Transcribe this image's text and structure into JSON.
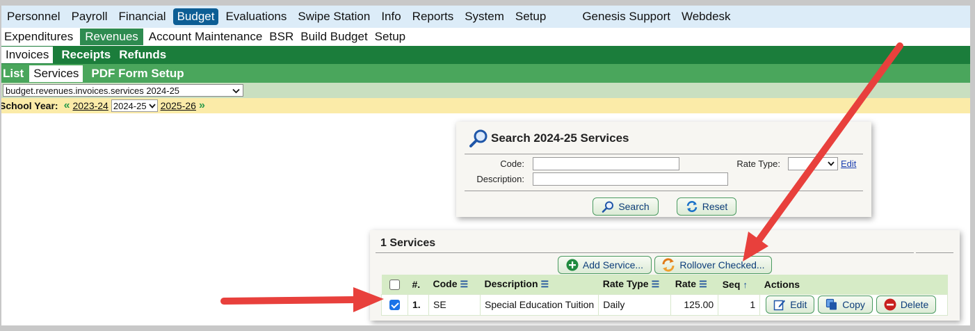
{
  "menu_main": [
    "Personnel",
    "Payroll",
    "Financial",
    "Budget",
    "Evaluations",
    "Swipe Station",
    "Info",
    "Reports",
    "System",
    "Setup",
    "Genesis Support",
    "Webdesk"
  ],
  "menu_budget": [
    "Expenditures",
    "Revenues",
    "Account Maintenance",
    "BSR",
    "Build Budget",
    "Setup"
  ],
  "menu_revenues": [
    "Invoices",
    "Receipts",
    "Refunds"
  ],
  "menu_invoices": [
    "List",
    "Services",
    "PDF Form Setup"
  ],
  "page_select": "budget.revenues.invoices.services 2024-25",
  "school_year": {
    "label": "School Year:",
    "prev": "2023-24",
    "current": "2024-25",
    "next": "2025-26"
  },
  "search": {
    "title": "Search 2024-25 Services",
    "code_label": "Code:",
    "description_label": "Description:",
    "rate_type_label": "Rate Type:",
    "edit_link": "Edit",
    "search_button": "Search",
    "reset_button": "Reset"
  },
  "services": {
    "title": "1 Services",
    "add_button": "Add Service...",
    "rollover_button": "Rollover Checked...",
    "columns": [
      "#.",
      "Code",
      "Description",
      "Rate Type",
      "Rate",
      "Seq",
      "Actions"
    ],
    "rows": [
      {
        "num": "1.",
        "code": "SE",
        "description": "Special Education Tuition",
        "rate_type": "Daily",
        "rate": "125.00",
        "seq": "1",
        "checked": true
      }
    ],
    "edit_button": "Edit",
    "copy_button": "Copy",
    "delete_button": "Delete"
  },
  "colors": {
    "arrow": "#e8403c",
    "active_budget": "#0d5e95",
    "green_dark": "#1b7d3b",
    "green_light": "#4aa65c"
  }
}
